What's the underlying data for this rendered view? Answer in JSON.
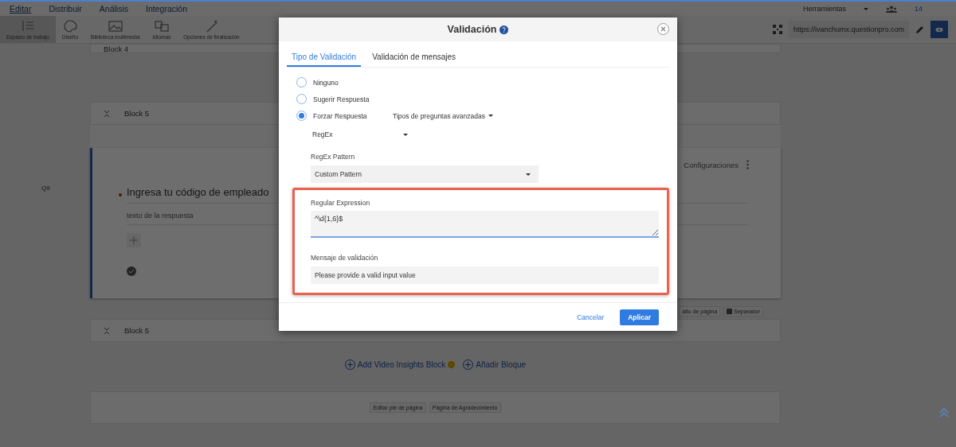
{
  "menu": [
    {
      "label": "Editar",
      "selected": true
    },
    {
      "label": "Distribuir",
      "selected": false
    },
    {
      "label": "Análisis",
      "selected": false
    },
    {
      "label": "Integración",
      "selected": false
    }
  ],
  "tools_menu": "Herramientas",
  "collaborators": "14",
  "toolbar": [
    {
      "label": "Espacio de trabajo",
      "kind": "workspace",
      "selected": true
    },
    {
      "label": "Diseño",
      "kind": "palette",
      "selected": false
    },
    {
      "label": "Biblioteca multimedia",
      "kind": "image",
      "selected": false
    },
    {
      "label": "Idiomas",
      "kind": "language",
      "selected": false
    },
    {
      "label": "Opciones de finalización",
      "kind": "wand",
      "selected": false
    }
  ],
  "survey_url": "https://ivanchumx.questionpro.com",
  "top_block": "Block 4",
  "block": "Block 5",
  "question": {
    "number": "Q9",
    "required": true,
    "text": "Ingresa tu código de empleado",
    "answer_placeholder": "texto de la respuesta",
    "settings": "Configuraciones"
  },
  "page_break": {
    "label": "alto de página",
    "separator": {
      "label": "Separador",
      "checked": true
    }
  },
  "next_block": "Block 5",
  "add_links": [
    {
      "label": "Add Video Insights Block",
      "kind": "video"
    },
    {
      "label": "Añadir Bloque",
      "kind": "block"
    }
  ],
  "footer_buttons": [
    "Editar pie de página",
    "Página de Agradecimiento"
  ],
  "dialog": {
    "title": "Validación",
    "tabs": [
      {
        "label": "Tipo de Validación",
        "selected": true
      },
      {
        "label": "Validación de mensajes",
        "selected": false
      }
    ],
    "options": [
      {
        "label": "Ninguno",
        "selected": false
      },
      {
        "label": "Sugerir Respuesta",
        "selected": false
      },
      {
        "label": "Forzar Respuesta",
        "selected": true
      }
    ],
    "advanced_dropdown": "Tipos de preguntas avanzadas",
    "type_select": "RegEx",
    "pattern_label": "RegEx Pattern",
    "pattern_select": "Custom Pattern",
    "regex_label": "Regular Expression",
    "regex_value": "^\\d{1,6}$",
    "message_label": "Mensaje de validación",
    "message_value": "Please provide a valid input value",
    "buttons": [
      {
        "label": "Cancelar",
        "kind": "link"
      },
      {
        "label": "Aplicar",
        "kind": "primary"
      }
    ]
  }
}
